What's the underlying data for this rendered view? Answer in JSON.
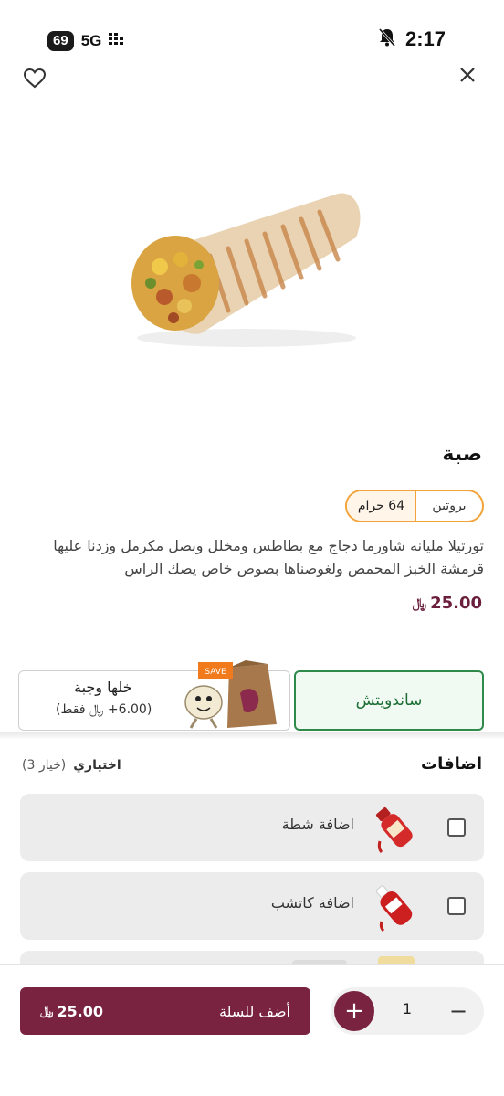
{
  "status_bar": {
    "battery": "69",
    "network": "5G",
    "time": "2:17"
  },
  "product": {
    "title": "صبة",
    "protein_label": "بروتين",
    "protein_value": "64 جرام",
    "description": "تورتيلا مليانه شاورما دجاج مع بطاطس ومخلل وبصل مكرمل وزدنا عليها قرمشة الخبز المحمص ولغوصناها بصوص خاص يصك الراس",
    "price": "25.00",
    "currency_symbol": "﷼"
  },
  "options": {
    "sandwich_label": "ساندويتش",
    "meal_title": "خلها وجبة",
    "meal_subtitle": "(6.00+ ﷼ فقط)",
    "save_sign": "SAVE"
  },
  "addons": {
    "title": "اضافات",
    "optional_label": "اختياري",
    "choices_label": "(خيار 3)",
    "items": [
      {
        "label": "اضافة شطة",
        "icon": "hot-sauce-bottle"
      },
      {
        "label": "اضافة كاتشب",
        "icon": "ketchup-bottle"
      },
      {
        "label": "",
        "icon": "fries"
      }
    ]
  },
  "bottom_bar": {
    "add_to_cart_label": "أضف للسلة",
    "cart_price": "25.00",
    "quantity": "1",
    "plus": "+",
    "minus": "−"
  },
  "colors": {
    "brand": "#7a2340",
    "accent_green": "#2e8a4a",
    "badge_orange": "#f2a33a"
  }
}
